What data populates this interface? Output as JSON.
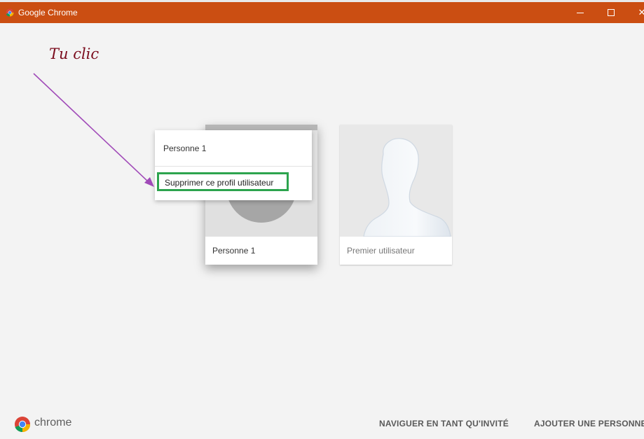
{
  "window": {
    "title": "Google Chrome",
    "accent_color": "#cb4e12"
  },
  "annotation": {
    "text": "Tu clic",
    "text_color": "#7a0b1c",
    "arrow_color": "#a04ab8"
  },
  "profiles": [
    {
      "name": "Personne 1"
    },
    {
      "name": "Premier utilisateur"
    }
  ],
  "context_menu": {
    "title": "Personne 1",
    "delete_label": "Supprimer ce profil utilisateur",
    "highlight_color": "#2da44e"
  },
  "footer": {
    "brand": "chrome",
    "guest_button": "NAVIGUER EN TANT QU'INVITÉ",
    "add_button": "AJOUTER UNE PERSONNE"
  },
  "icons": {
    "window_icon": "chrome-logo-icon",
    "minimize": "minimize-icon",
    "maximize": "maximize-icon",
    "close": "close-icon",
    "footer_logo": "chrome-logo-icon"
  }
}
